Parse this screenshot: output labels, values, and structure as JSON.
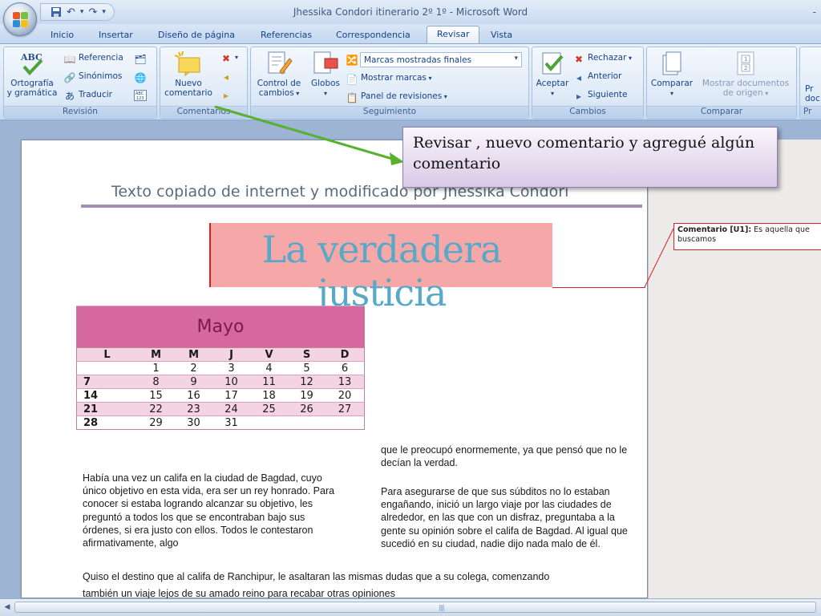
{
  "window": {
    "title": "Jhessika Condori itinerario 2º 1º - Microsoft Word",
    "minimize": "-"
  },
  "qat": {
    "save_icon": "save-icon",
    "undo_icon": "undo-icon",
    "redo_icon": "redo-icon"
  },
  "tabs": [
    {
      "label": "Inicio"
    },
    {
      "label": "Insertar"
    },
    {
      "label": "Diseño de página"
    },
    {
      "label": "Referencias"
    },
    {
      "label": "Correspondencia"
    },
    {
      "label": "Revisar",
      "active": true
    },
    {
      "label": "Vista"
    }
  ],
  "ribbon": {
    "revision": {
      "label": "Revisión",
      "spelling_1": "Ortografía",
      "spelling_2": "y gramática",
      "spelling_icon_text": "ABC",
      "reference": "Referencia",
      "synonyms": "Sinónimos",
      "translate": "Traducir",
      "small_icon_text": "ABC\n123"
    },
    "comments": {
      "label": "Comentarios",
      "new_1": "Nuevo",
      "new_2": "comentario"
    },
    "tracking": {
      "label": "Seguimiento",
      "control_1": "Control de",
      "control_2": "cambios",
      "balloons": "Globos",
      "markup_combo": "Marcas mostradas finales",
      "show_markup": "Mostrar marcas",
      "review_pane": "Panel de revisiones"
    },
    "changes": {
      "label": "Cambios",
      "accept": "Aceptar",
      "reject": "Rechazar",
      "previous": "Anterior",
      "next": "Siguiente"
    },
    "compare": {
      "label": "Comparar",
      "compare": "Comparar",
      "show_source_1": "Mostrar documentos",
      "show_source_2": "de origen",
      "icon_digit_1": "1",
      "icon_digit_2": "2"
    },
    "protect": {
      "label": "Pr",
      "btn_1": "Pr",
      "btn_2": "doc"
    }
  },
  "document": {
    "heading": "Texto copiado de internet y modificado por Jhessika Condori",
    "wordart": "La verdadera justicia",
    "calendar": {
      "month": "Mayo",
      "days": [
        "L",
        "M",
        "M",
        "J",
        "V",
        "S",
        "D"
      ],
      "weeks": [
        [
          "",
          "1",
          "2",
          "3",
          "4",
          "5",
          "6"
        ],
        [
          "7",
          "8",
          "9",
          "10",
          "11",
          "12",
          "13"
        ],
        [
          "14",
          "15",
          "16",
          "17",
          "18",
          "19",
          "20"
        ],
        [
          "21",
          "22",
          "23",
          "24",
          "25",
          "26",
          "27"
        ],
        [
          "28",
          "29",
          "30",
          "31",
          "",
          "",
          ""
        ]
      ]
    },
    "col_right_1": "que le preocupó enormemente, ya que pensó que no le decían la verdad.",
    "col_left": "Había una vez un califa en la ciudad de Bagdad, cuyo único objetivo en esta vida, era ser un rey honrado. Para conocer si estaba logrando alcanzar su objetivo, les preguntó a todos los que se encontraban bajo sus órdenes, si era justo con ellos. Todos le contestaron afirmativamente, algo",
    "col_right_2": "Para asegurarse de que sus súbditos no lo estaban engañando, inició un largo viaje por las ciudades de alrededor, en las que con un disfraz, preguntaba a la gente su opinión sobre el califa de Bagdad. Al igual que sucedió en su ciudad, nadie dijo nada malo de él.",
    "bottom_line_1": "Quiso el destino que al califa de Ranchipur, le asaltaran las mismas dudas que a su colega, comenzando",
    "bottom_line_2": "también un viaje lejos de su amado reino para recabar otras opiniones"
  },
  "comment": {
    "tag": "Comentario [U1]:",
    "text_1": " Es aquella que",
    "text_2": "buscamos"
  },
  "callout": {
    "text": "Revisar , nuevo comentario y agregué algún comentario"
  },
  "colors": {
    "accent": "#5ab030",
    "comment_border": "#e02020",
    "calendar_header": "#d5699e"
  }
}
